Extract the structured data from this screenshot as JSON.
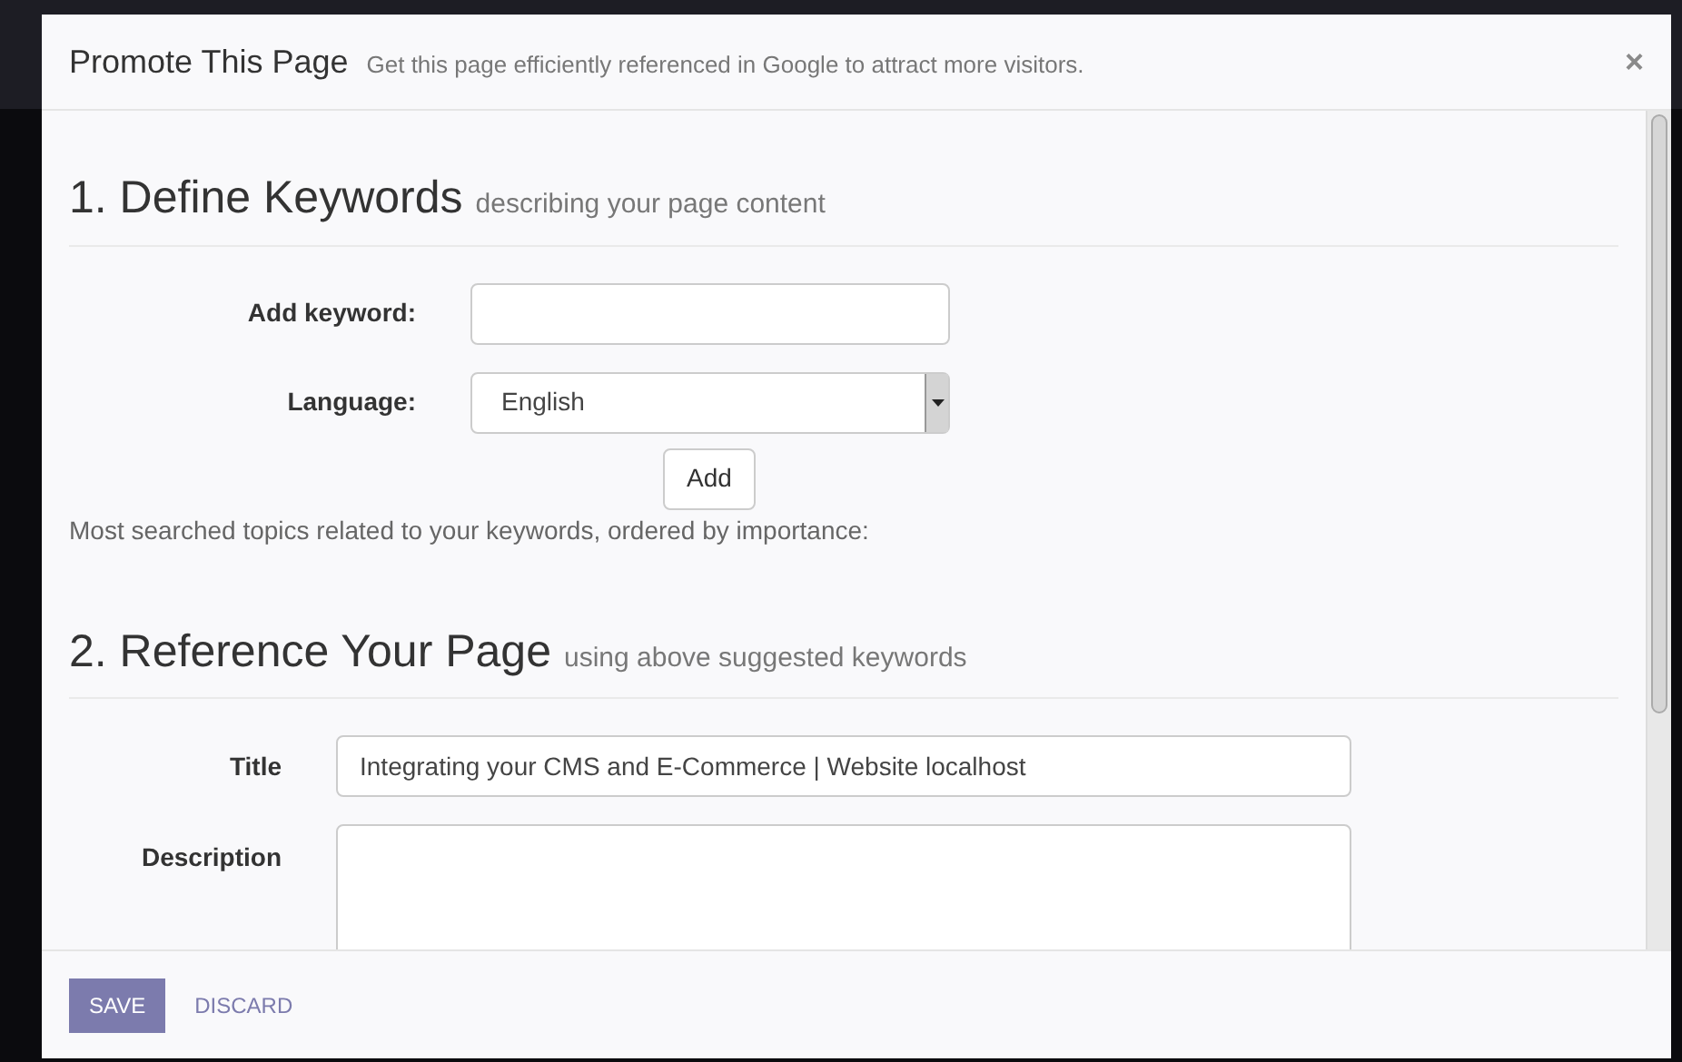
{
  "dialog": {
    "title": "Promote This Page",
    "subtitle": "Get this page efficiently referenced in Google to attract more visitors.",
    "close": "×"
  },
  "section_1": {
    "heading": "1. Define Keywords",
    "subheading": "describing your page content",
    "keyword_label": "Add keyword:",
    "language_label": "Language:",
    "language_value": "English",
    "add_button": "Add",
    "note": "Most searched topics related to your keywords, ordered by importance:"
  },
  "section_2": {
    "heading": "2. Reference Your Page",
    "subheading": "using above suggested keywords",
    "title_label": "Title",
    "title_value": "Integrating your CMS and E-Commerce | Website localhost",
    "description_label": "Description"
  },
  "footer": {
    "buttons": [
      {
        "label": "SAVE",
        "kind": "primary"
      },
      {
        "label": "DISCARD",
        "kind": "link"
      }
    ]
  }
}
